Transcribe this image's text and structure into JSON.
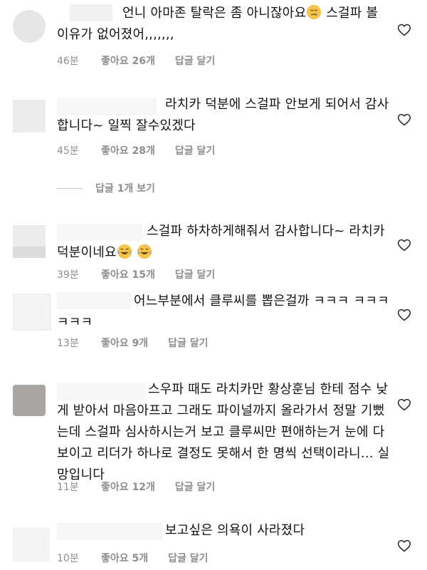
{
  "comments": [
    {
      "text": "언니 아마존 탈락은 좀 아니잖아요",
      "text_after": " 스걸파 볼 이유가 없어졌어,,,,,,,",
      "emoji": "crying-face",
      "time": "46분",
      "likes": "좋아요 26개",
      "reply": "답글 달기"
    },
    {
      "text": "라치카 덕분에 스걸파 안보게 되어서 감사합니다~ 일찍 잘수있겠다",
      "time": "45분",
      "likes": "좋아요 28개",
      "reply": "답글 달기"
    },
    {
      "text": "스걸파 하차하게해줘서 감사합니다~ 라치카 덕분이네요",
      "emoji": "tears-of-joy",
      "time": "39분",
      "likes": "좋아요 15개",
      "reply": "답글 달기"
    },
    {
      "text": "어느부분에서 클루씨를 뽑은걸까 ㅋㅋㅋ ㅋㅋㅋㅋㅋㅋ",
      "time": "13분",
      "likes": "좋아요 9개",
      "reply": "답글 달기"
    },
    {
      "text": "스우파 때도 라치카만 황상훈님 한테 점수 낮게 받아서 마음아프고 그래도 파이널까지 올라가서 정말 기뻤는데 스걸파 심사하시는거 보고 클루씨만 편애하는거 눈에 다 보이고 리더가 하나로 결정도 못해서 한 명씩 선택이라니... 실망입니다",
      "time": "11분",
      "likes": "좋아요 12개",
      "reply": "답글 달기"
    },
    {
      "text": "보고싶은 의욕이 사라졌다",
      "time": "10분",
      "likes": "좋아요 5개",
      "reply": "답글 달기"
    }
  ],
  "view_replies": "답글 1개 보기",
  "colors": {
    "meta": "#8e8e8e",
    "text": "#131313"
  }
}
